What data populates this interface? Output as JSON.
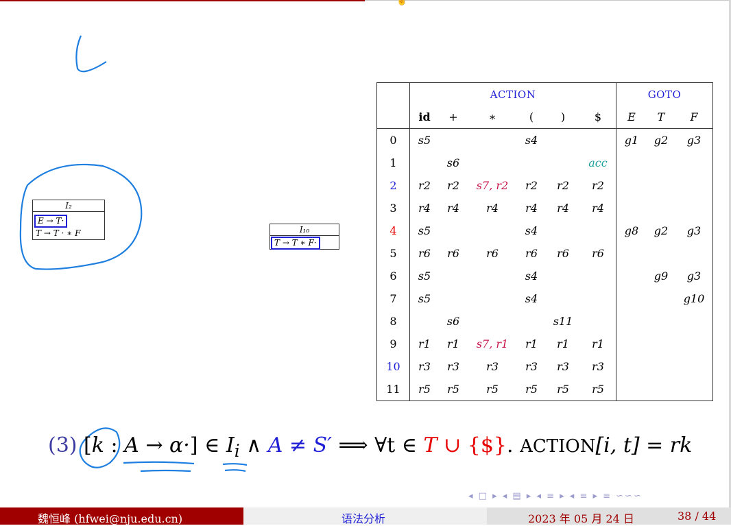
{
  "item_box_left": {
    "title": "I₂",
    "item1": "E → T·",
    "item2": "T → T · ∗ F"
  },
  "item_box_right": {
    "title": "I₁₀",
    "item1": "T → T ∗ F·"
  },
  "table": {
    "group_action": "ACTION",
    "group_goto": "GOTO",
    "columns": [
      "id",
      "+",
      "∗",
      "(",
      ")",
      "$",
      "E",
      "T",
      "F"
    ],
    "rows": [
      {
        "state": "0",
        "cells": [
          "s5",
          "",
          "",
          "s4",
          "",
          "",
          "g1",
          "g2",
          "g3"
        ]
      },
      {
        "state": "1",
        "cells": [
          "",
          "s6",
          "",
          "",
          "",
          "acc",
          "",
          "",
          ""
        ]
      },
      {
        "state": "2",
        "cells": [
          "r2",
          "r2",
          "s7, r2",
          "r2",
          "r2",
          "r2",
          "",
          "",
          ""
        ]
      },
      {
        "state": "3",
        "cells": [
          "r4",
          "r4",
          "r4",
          "r4",
          "r4",
          "r4",
          "",
          "",
          ""
        ]
      },
      {
        "state": "4",
        "cells": [
          "s5",
          "",
          "",
          "s4",
          "",
          "",
          "g8",
          "g2",
          "g3"
        ]
      },
      {
        "state": "5",
        "cells": [
          "r6",
          "r6",
          "r6",
          "r6",
          "r6",
          "r6",
          "",
          "",
          ""
        ]
      },
      {
        "state": "6",
        "cells": [
          "s5",
          "",
          "",
          "s4",
          "",
          "",
          "",
          "g9",
          "g3"
        ]
      },
      {
        "state": "7",
        "cells": [
          "s5",
          "",
          "",
          "s4",
          "",
          "",
          "",
          "",
          "g10"
        ]
      },
      {
        "state": "8",
        "cells": [
          "",
          "s6",
          "",
          "",
          "s11",
          "",
          "",
          "",
          ""
        ]
      },
      {
        "state": "9",
        "cells": [
          "r1",
          "r1",
          "s7, r1",
          "r1",
          "r1",
          "r1",
          "",
          "",
          ""
        ]
      },
      {
        "state": "10",
        "cells": [
          "r3",
          "r3",
          "r3",
          "r3",
          "r3",
          "r3",
          "",
          "",
          ""
        ]
      },
      {
        "state": "11",
        "cells": [
          "r5",
          "r5",
          "r5",
          "r5",
          "r5",
          "r5",
          "",
          "",
          ""
        ]
      }
    ]
  },
  "formula": {
    "num": "(3)",
    "lb": "[",
    "k": "k",
    "colon": " : ",
    "A": "A",
    "arrow": " → ",
    "alpha": "α·",
    "rb": "]",
    "in": " ∈ ",
    "I": "I",
    "i": "i",
    "and": " ∧ ",
    "neq": "A ≠ S′",
    "implies": "  ⟹  ",
    "forall": "∀t ∈ ",
    "T": "T",
    "cup": " ∪ ",
    "dollar": "{$}",
    "dot": ". ",
    "action": "ACTION",
    "rhs": "[i, t] = rk"
  },
  "nav_symbols": "◂ □ ▸  ◂ ▤ ▸  ◂ ≡ ▸  ◂ ≡ ▸   ≡   ∽∽∽",
  "footer": {
    "author": "魏恒峰  (hfwei@nju.edu.cn)",
    "title": "语法分析",
    "date": "2023 年 05 月 24 日",
    "page": "38 / 44"
  },
  "colors": {
    "accent_red": "#a00000",
    "blue": "#1f1fd6",
    "conflict": "#c8144b",
    "accept": "#1a9fa0"
  }
}
